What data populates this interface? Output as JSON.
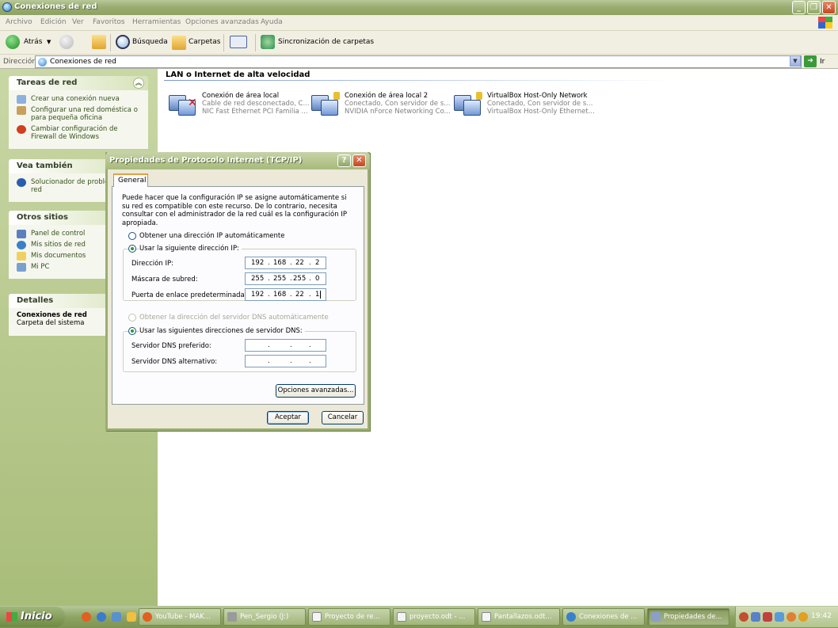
{
  "window": {
    "title": "Conexiones de red"
  },
  "menu": [
    "Archivo",
    "Edición",
    "Ver",
    "Favoritos",
    "Herramientas",
    "Opciones avanzadas",
    "Ayuda"
  ],
  "toolbar": {
    "back": "Atrás",
    "search": "Búsqueda",
    "folders": "Carpetas",
    "sync": "Sincronización de carpetas"
  },
  "address": {
    "label": "Dirección",
    "value": "Conexiones de red",
    "go": "Ir"
  },
  "sidebar": {
    "tasks": {
      "title": "Tareas de red",
      "items": [
        "Crear una conexión nueva",
        "Configurar una red doméstica o para pequeña oficina",
        "Cambiar configuración de Firewall de Windows"
      ]
    },
    "see_also": {
      "title": "Vea también",
      "items": [
        "Solucionador de problemas de red"
      ]
    },
    "other_places": {
      "title": "Otros sitios",
      "items": [
        "Panel de control",
        "Mis sitios de red",
        "Mis documentos",
        "Mi PC"
      ]
    },
    "details": {
      "title": "Detalles",
      "name": "Conexiones de red",
      "type": "Carpeta del sistema"
    }
  },
  "content": {
    "group_title": "LAN o Internet de alta velocidad",
    "connections": [
      {
        "name": "Conexión de área local",
        "status": "Cable de red desconectado, C...",
        "device": "NIC Fast Ethernet PCI Familia ..."
      },
      {
        "name": "Conexión de área local 2",
        "status": "Conectado, Con servidor de s...",
        "device": "NVIDIA nForce Networking Co..."
      },
      {
        "name": "VirtualBox Host-Only Network",
        "status": "Conectado, Con servidor de s...",
        "device": "VirtualBox Host-Only Ethernet..."
      }
    ]
  },
  "dialog": {
    "title": "Propiedades de Protocolo Internet (TCP/IP)",
    "tab": "General",
    "description": "Puede hacer que la configuración IP se asigne automáticamente si su red es compatible con este recurso. De lo contrario, necesita consultar con el administrador de la red cuál es la configuración IP apropiada.",
    "auto_ip": "Obtener una dirección IP automáticamente",
    "manual_ip": "Usar la siguiente dirección IP:",
    "ip_label": "Dirección IP:",
    "ip": [
      "192",
      "168",
      "22",
      "2"
    ],
    "mask_label": "Máscara de subred:",
    "mask": [
      "255",
      "255",
      "255",
      "0"
    ],
    "gateway_label": "Puerta de enlace predeterminada:",
    "gateway": [
      "192",
      "168",
      "22",
      "1"
    ],
    "auto_dns": "Obtener la dirección del servidor DNS automáticamente",
    "manual_dns": "Usar las siguientes direcciones de servidor DNS:",
    "dns1_label": "Servidor DNS preferido:",
    "dns2_label": "Servidor DNS alternativo:",
    "advanced": "Opciones avanzadas...",
    "ok": "Aceptar",
    "cancel": "Cancelar"
  },
  "taskbar": {
    "start": "Inicio",
    "tasks": [
      "YouTube - MAK...",
      "Pen_Sergio (J:)",
      "Proyecto de re...",
      "proyecto.odt - ...",
      "Pantallazos.odt...",
      "Conexiones de ...",
      "Propiedades de..."
    ],
    "clock": "19:42"
  }
}
